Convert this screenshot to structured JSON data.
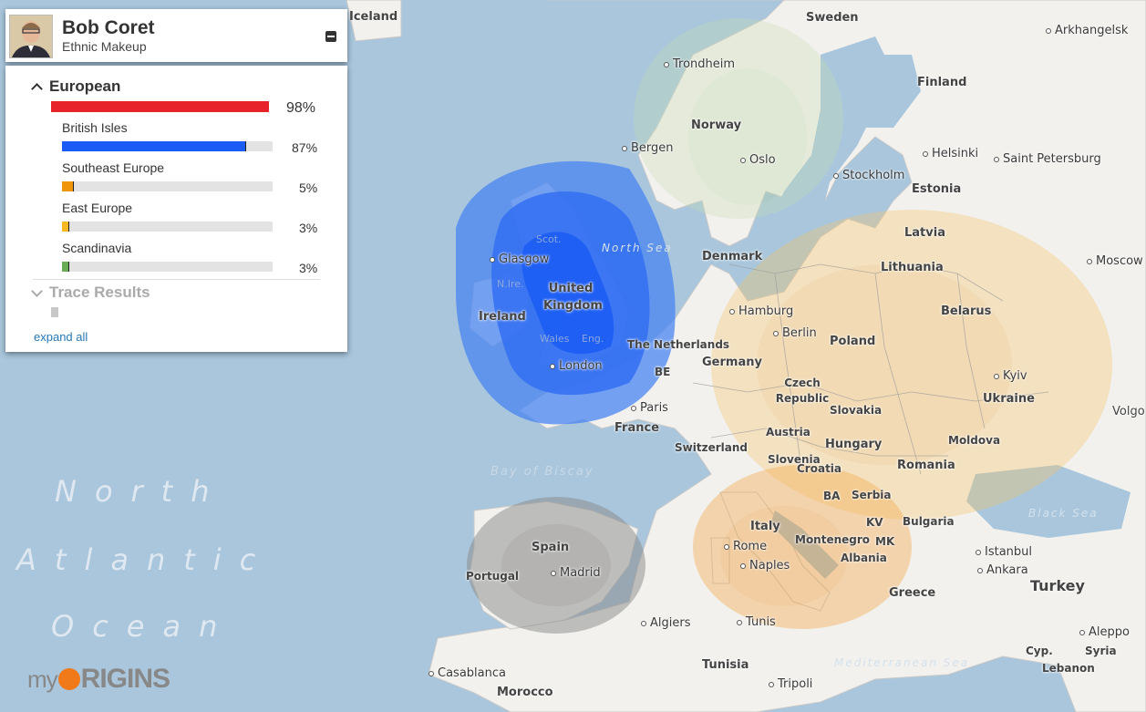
{
  "profile": {
    "name": "Bob Coret",
    "subtitle": "Ethnic Makeup"
  },
  "panel": {
    "group": {
      "label": "European",
      "percent_text": "98%",
      "value": 98,
      "color": "#e8222a"
    },
    "regions": [
      {
        "label": "British Isles",
        "percent_text": "87%",
        "value": 87,
        "color": "#1a5cf5"
      },
      {
        "label": "Southeast Europe",
        "percent_text": "5%",
        "value": 5,
        "color": "#f0940a"
      },
      {
        "label": "East Europe",
        "percent_text": "3%",
        "value": 3,
        "color": "#f5b820"
      },
      {
        "label": "Scandinavia",
        "percent_text": "3%",
        "value": 3,
        "color": "#6aab55"
      }
    ],
    "trace": {
      "label": "Trace Results"
    },
    "expand_all": "expand all"
  },
  "logo": {
    "my": "my",
    "origins": "RIGINS"
  },
  "map": {
    "ocean_words": [
      "North",
      "Atlantic",
      "Ocean"
    ],
    "seas": [
      "Bay of Biscay",
      "Black Sea",
      "Mediterranean Sea",
      "North Sea"
    ],
    "countries": [
      "Sweden",
      "Finland",
      "Norway",
      "Estonia",
      "Latvia",
      "Denmark",
      "Lithuania",
      "Belarus",
      "Poland",
      "Ireland",
      "United Kingdom",
      "Scot.",
      "Wales",
      "Eng.",
      "N.Ire.",
      "The Netherlands",
      "BE",
      "Germany",
      "Czech Republic",
      "Slovakia",
      "Ukraine",
      "France",
      "Austria",
      "Hungary",
      "Moldova",
      "Switzerland",
      "Slovenia",
      "Croatia",
      "Romania",
      "BA",
      "Serbia",
      "Spain",
      "Portugal",
      "Italy",
      "Montenegro",
      "KV",
      "Bulgaria",
      "MK",
      "Albania",
      "Greece",
      "Turkey",
      "Syria",
      "Cyp.",
      "Lebanon",
      "Tunisia",
      "Morocco",
      "Iceland"
    ],
    "cities": [
      "Trondheim",
      "Arkhangelsk",
      "Bergen",
      "Oslo",
      "Helsinki",
      "Saint Petersburg",
      "Stockholm",
      "Moscow",
      "Glasgow",
      "Hamburg",
      "Berlin",
      "London",
      "Paris",
      "Kyiv",
      "Madrid",
      "Rome",
      "Naples",
      "Istanbul",
      "Ankara",
      "Algiers",
      "Tunis",
      "Aleppo",
      "Casablanca",
      "Tripoli",
      "Volgo"
    ]
  }
}
